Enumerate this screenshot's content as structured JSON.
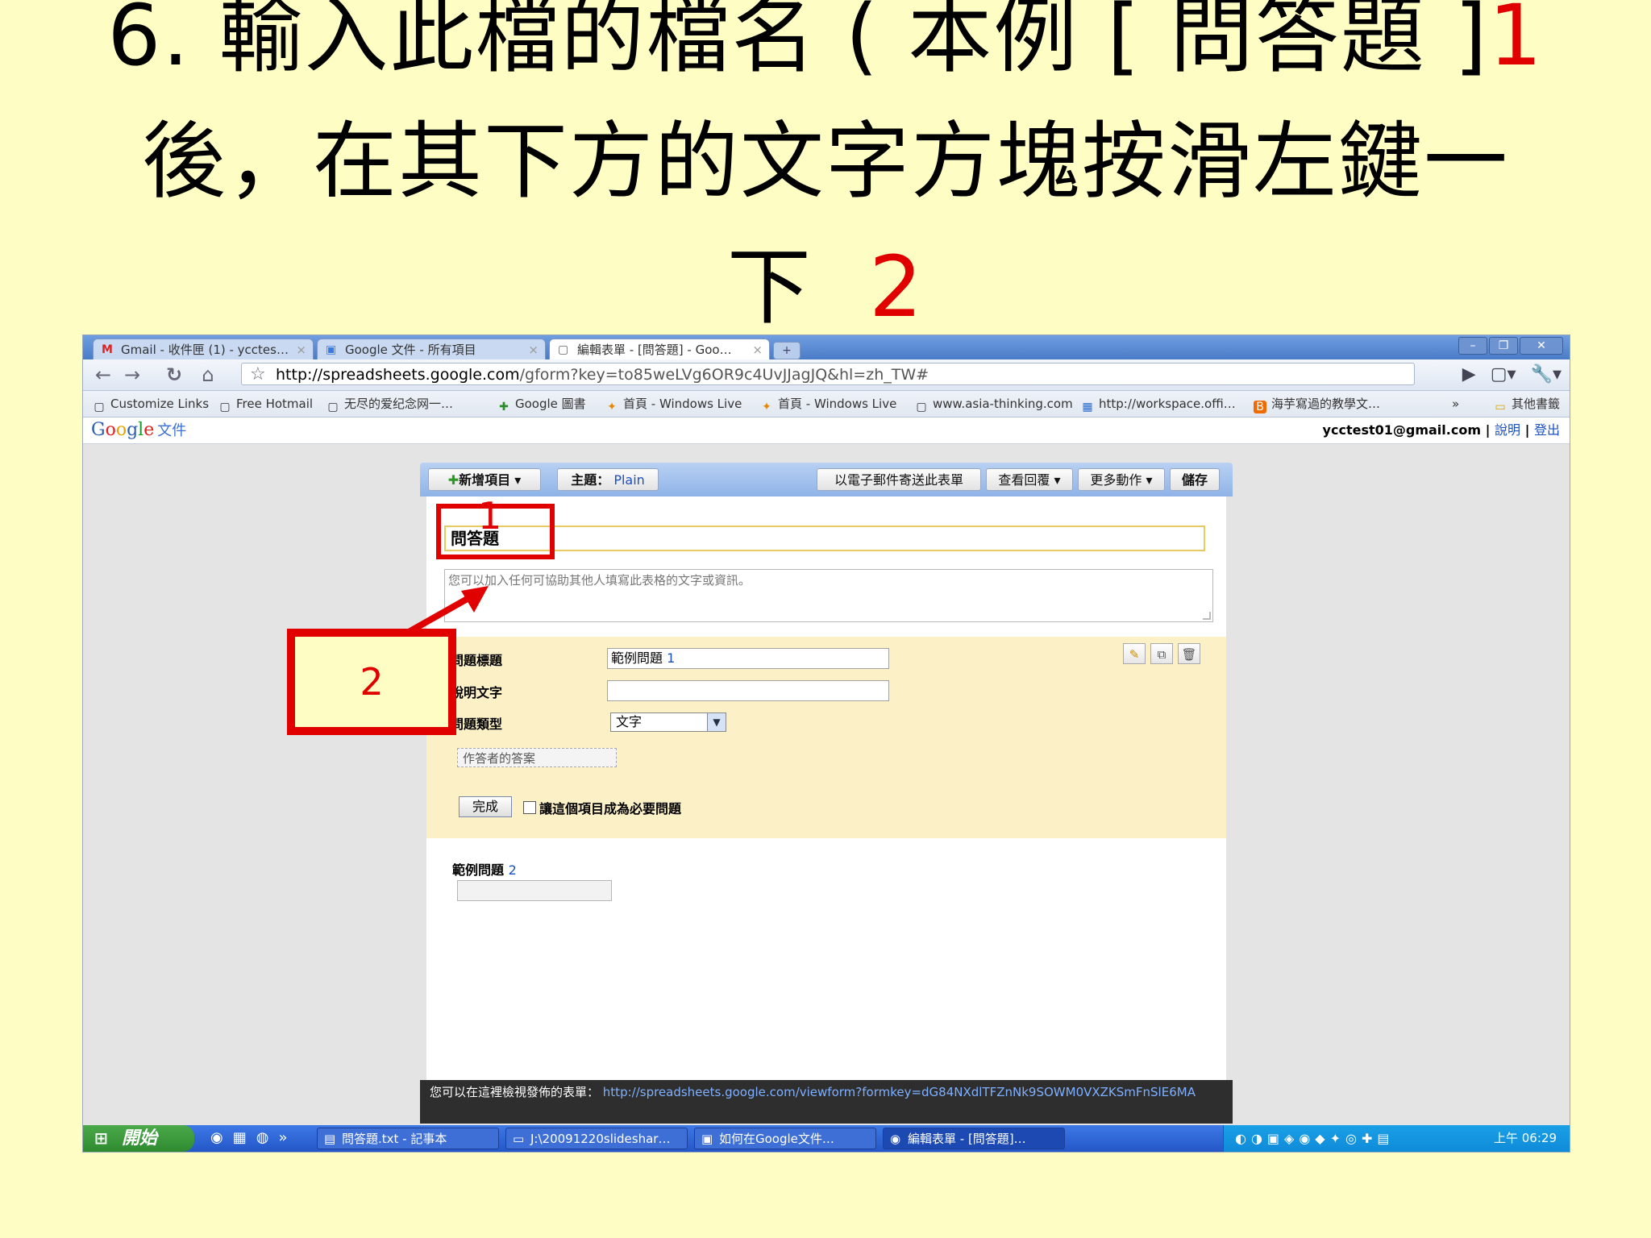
{
  "slide": {
    "title_line1_prefix": "6. 輸入此檔的檔名 ( 本例 [ 問答題 ]",
    "title_line1_num": "1",
    "title_line2": "後，在其下方的文字方塊按滑左鍵一",
    "title_line3_prefix": "下",
    "title_line3_num": "2"
  },
  "browser": {
    "tabs": [
      {
        "label": "Gmail - 收件匣 (1) - ycctes…",
        "icon": "gmail-icon"
      },
      {
        "label": "Google 文件 - 所有項目",
        "icon": "google-docs-icon"
      },
      {
        "label": "編輯表單 - [問答題] - Goo…",
        "icon": "page-icon"
      }
    ],
    "newtab_label": "+",
    "url_host": "http://spreadsheets.google.com",
    "url_rest": "/gform?key=to85weLVg6OR9c4UvJJagJQ&hl=zh_TW#",
    "bookmarks": [
      "Customize Links",
      "Free Hotmail",
      "无尽的爱纪念网一…",
      "Google 圖書",
      "首頁 - Windows Live",
      "首頁 - Windows Live",
      "www.asia-thinking.com",
      "http://workspace.offi…",
      "海芋寫過的教學文…"
    ],
    "bookmarks_more": "»",
    "other_bookmarks": "其他書籤"
  },
  "gdocs": {
    "logo_letters": [
      "G",
      "o",
      "o",
      "g",
      "l",
      "e"
    ],
    "logo_suffix": "文件",
    "account_email": "ycctest01@gmail.com",
    "help_link": "說明",
    "signout_link": "登出"
  },
  "form": {
    "add_item": "新增項目",
    "theme_label": "主題：",
    "theme_value": "Plain",
    "email_form": "以電子郵件寄送此表單",
    "view_responses": "查看回覆",
    "more_actions": "更多動作",
    "save": "儲存",
    "title_value": "問答題",
    "description_placeholder": "您可以加入任何可協助其他人填寫此表格的文字或資訊。",
    "question1": {
      "title_label": "問題標題",
      "title_value": "範例問題",
      "title_num": "1",
      "help_label": "說明文字",
      "help_value": "",
      "type_label": "問題類型",
      "type_value": "文字",
      "answer_placeholder": "作答者的答案",
      "done": "完成",
      "required_label": "讓這個項目成為必要問題"
    },
    "question2": {
      "title": "範例問題",
      "num": "2"
    },
    "footer_text": "您可以在這裡檢視發佈的表單：",
    "footer_url": "http://spreadsheets.google.com/viewform?formkey=dG84NXdlTFZnNk9SOWM0VXZKSmFnSlE6MA"
  },
  "taskbar": {
    "start": "開始",
    "tasks": [
      "問答題.txt - 記事本",
      "J:\\20091220slideshar…",
      "如何在Google文件…",
      "編輯表單 - [問答題]…"
    ],
    "clock": "上午 06:29"
  },
  "annotations": {
    "label1": "1",
    "label2": "2",
    "color": "#e00000"
  }
}
